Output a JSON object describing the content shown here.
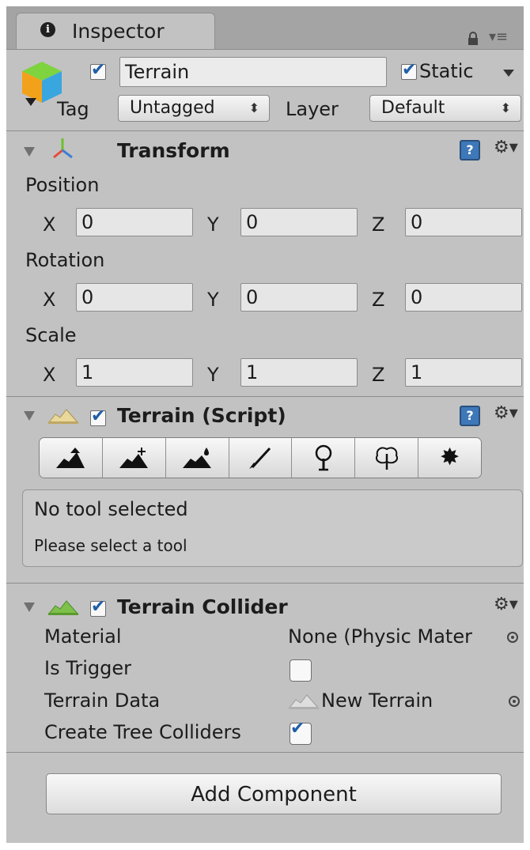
{
  "tab": {
    "title": "Inspector",
    "info_icon": "info-icon",
    "lock_icon": "lock-icon",
    "menu_icon": "tab-menu-icon"
  },
  "gameobject": {
    "active": true,
    "name": "Terrain",
    "static_label": "Static",
    "static_checked": true,
    "tag_label": "Tag",
    "tag_value": "Untagged",
    "layer_label": "Layer",
    "layer_value": "Default"
  },
  "transform": {
    "title": "Transform",
    "position_label": "Position",
    "rotation_label": "Rotation",
    "scale_label": "Scale",
    "position": {
      "x": "0",
      "y": "0",
      "z": "0"
    },
    "rotation": {
      "x": "0",
      "y": "0",
      "z": "0"
    },
    "scale": {
      "x": "1",
      "y": "1",
      "z": "1"
    },
    "axis": {
      "x": "X",
      "y": "Y",
      "z": "Z"
    }
  },
  "terrain_script": {
    "title": "Terrain (Script)",
    "enabled": true,
    "tools": [
      "raise-lower-icon",
      "paint-height-icon",
      "smooth-height-icon",
      "paint-texture-icon",
      "place-trees-icon",
      "paint-details-icon",
      "settings-icon"
    ],
    "status_title": "No tool selected",
    "status_text": "Please select a tool"
  },
  "terrain_collider": {
    "title": "Terrain Collider",
    "enabled": true,
    "material_label": "Material",
    "material_value": "None (Physic Mater",
    "is_trigger_label": "Is Trigger",
    "is_trigger": false,
    "terrain_data_label": "Terrain Data",
    "terrain_data_value": "New Terrain",
    "tree_colliders_label": "Create Tree Colliders",
    "tree_colliders": true
  },
  "add_component_label": "Add Component",
  "colors": {
    "panel": "#c2c2c2",
    "tab_strip": "#a4a4a4",
    "checkbox_tick": "#1f5ea8",
    "help_icon": "#3e78b8"
  }
}
